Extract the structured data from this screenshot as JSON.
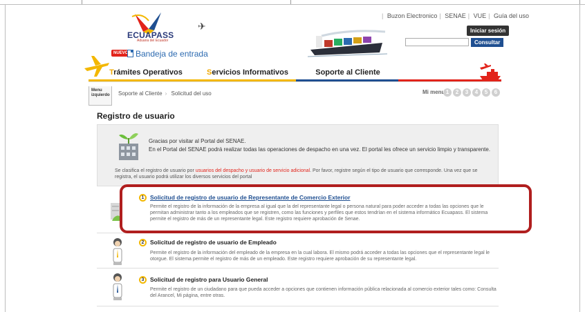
{
  "header": {
    "logo_name": "ECUAPASS",
    "logo_sub": "Aduana del Ecuador",
    "top_links": [
      "Buzon Electronico",
      "SENAE",
      "VUE",
      "Guía del uso"
    ],
    "login_button": "Iniciar sesión",
    "search_value": "",
    "consultar_button": "Consultar",
    "nuevo_badge": "NUEVO",
    "bandeja_link": "Bandeja de entrada"
  },
  "nav": {
    "tabs": [
      {
        "first": "T",
        "rest": "rámites Operativos"
      },
      {
        "first": "S",
        "rest": "ervicios Informativos"
      },
      {
        "first": "",
        "rest": "Soporte al Cliente"
      }
    ]
  },
  "breadcrumb": {
    "menu_tab": "Menu izquierdo",
    "items": [
      "Soporte al Cliente",
      "Solicitud del uso"
    ],
    "mimenu_label": "Mi menu",
    "mimenu_numbers": [
      "1",
      "2",
      "3",
      "4",
      "5",
      "6"
    ]
  },
  "page_title": "Registro de usuario",
  "welcome": {
    "line1": "Gracias por visitar al Portal del SENAE.",
    "line2": "En el Portal del SENAE podrá realizar todas las operaciones de despacho en una vez. El portal les ofrece un servicio limpio y transparente.",
    "note_pre": "Se clasifica el registro de usuario por ",
    "note_highlight": "usuarios del despacho y usuario de servicio adicional",
    "note_post": ". Por favor, registre según el tipo de usuario que corresponde. Una vez que se registra, el usuario podrá utilizar los diversos servicios del portal"
  },
  "options": [
    {
      "number": "1",
      "title": "Solicitud de registro de usuario de Representante de Comercio Exterior",
      "desc": "Permite el registro de la información de la empresa al igual que la del representante legal o persona natural para poder acceder a todas las opciones que le permitan administrar tanto a los empleados que se registren, como las funciones y perfiles que estos tendrían en el sistema informático Ecuapass. El sistema permite el registro de más de un representante legal. Este registro requiere aprobación de Senae."
    },
    {
      "number": "2",
      "title": "Solicitud de registro de usuario de Empleado",
      "desc": "Permite el registro de la información del empleado de la empresa en la cual labora. El mismo podrá acceder a todas las opciones que el representante legal le otorgue. El sistema permite el registro de más de un empleado. Este registro requiere aprobación de su representante legal."
    },
    {
      "number": "3",
      "title": "Solicitud de registro para Usuario General",
      "desc": "Permite el registro de un ciudadano para que pueda acceder a opciones que contienen información pública relacionada al comercio exterior tales como: Consulta del Arancel, Mi página, entre otras."
    }
  ],
  "colors": {
    "brand_blue": "#1f4f91",
    "brand_yellow": "#f3b700",
    "brand_red": "#e2231a",
    "highlight_box": "#b01e1e"
  }
}
